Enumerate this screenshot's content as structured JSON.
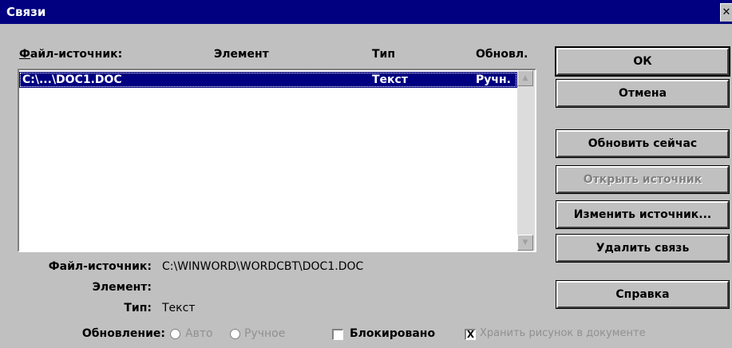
{
  "window": {
    "title": "Связи",
    "close_glyph": "✕"
  },
  "list": {
    "headers": {
      "source": "Файл-источник:",
      "element": "Элемент",
      "type": "Тип",
      "update": "Обновл."
    },
    "rows": [
      {
        "source": "C:\\...\\DOC1.DOC",
        "element": "",
        "type": "Текст",
        "update": "Ручн.",
        "selected": true
      }
    ]
  },
  "buttons": {
    "ok": "ОК",
    "cancel": "Отмена",
    "update_now": "Обновить сейчас",
    "open_source": "Открыть источник",
    "change_source": "Изменить источник...",
    "remove_link": "Удалить связь",
    "help": "Справка"
  },
  "details": {
    "source_label": "Файл-источник:",
    "source_value": "C:\\WINWORD\\WORDCBT\\DOC1.DOC",
    "element_label": "Элемент:",
    "element_value": "",
    "type_label": "Тип:",
    "type_value": "Текст"
  },
  "update": {
    "label": "Обновление:",
    "auto": "Авто",
    "manual": "Ручное",
    "locked": "Блокировано",
    "save_picture": "Хранить рисунок в документе",
    "save_picture_checked": true,
    "check_mark": "X"
  },
  "icons": {
    "scroll_up": "up-arrow-icon",
    "scroll_down": "down-arrow-icon"
  }
}
